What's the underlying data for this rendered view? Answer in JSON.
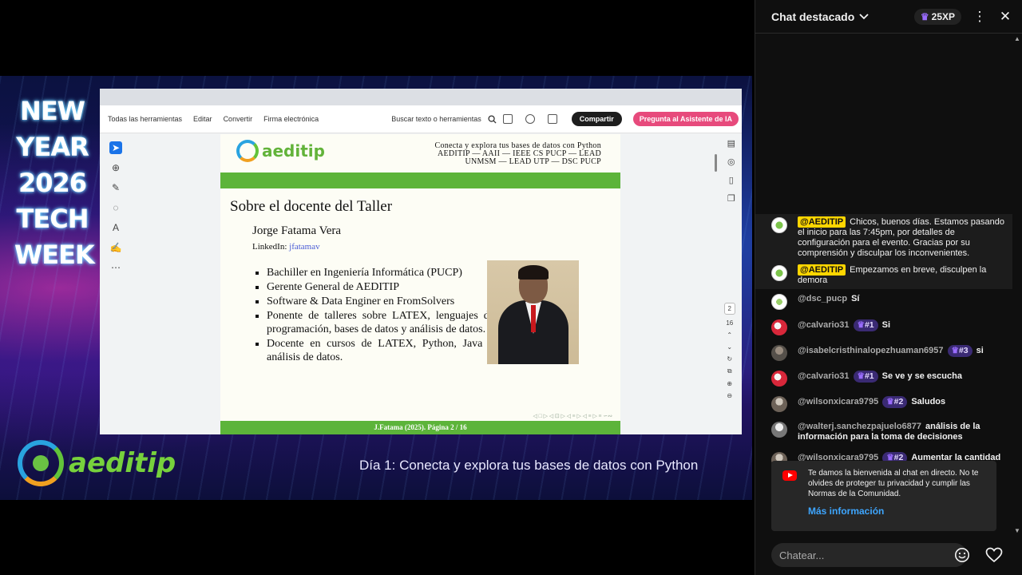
{
  "video": {
    "event_title": "NEW YEAR 2026 TECH WEEK",
    "brand_name": "aeditip",
    "caption": "Día 1: Conecta y explora tus bases de datos con Python"
  },
  "pdf_toolbar": {
    "all_tools": "Todas las herramientas",
    "edit": "Editar",
    "convert": "Convertir",
    "sign": "Firma electrónica",
    "search_placeholder": "Buscar texto o herramientas",
    "share_button": "Compartir",
    "ai_button": "Pregunta al Asistente de IA",
    "page_current": "2",
    "page_total": "16"
  },
  "slide": {
    "logo_text": "aeditip",
    "header_lines": [
      "Conecta y explora tus bases de datos con Python",
      "AEDITIP — AAII — IEEE CS PUCP — LEAD",
      "UNMSM — LEAD UTP — DSC PUCP"
    ],
    "title": "Sobre el docente del Taller",
    "name": "Jorge Fatama Vera",
    "linkedin_label": "LinkedIn:",
    "linkedin_handle": "jfatamav",
    "bullets": [
      "Bachiller en Ingeniería Informática (PUCP)",
      "Gerente General de AEDITIP",
      "Software & Data Enginer en FromSolvers",
      "Ponente de talleres sobre LATEX, lenguajes de programación, bases de datos y análisis de datos.",
      "Docente en cursos de LATEX, Python, Java y análisis de datos."
    ],
    "footer": "J.Fatama (2025). Página 2 / 16"
  },
  "chat": {
    "title": "Chat destacado",
    "xp": "25XP",
    "messages": [
      {
        "author": "@AEDITIP",
        "text": "Chicos, buenos días. Estamos pasando el inicio para las 7:45pm, por detalles de configuración para el evento. Gracias por su comprensión y disculpar los inconvenientes."
      },
      {
        "author": "@AEDITIP",
        "text": "Empezamos en breve, disculpen la demora"
      },
      {
        "author": "@dsc_pucp",
        "text": "Sí"
      },
      {
        "author": "@calvario31",
        "badge": "#1",
        "text": "Si"
      },
      {
        "author": "@isabelcristhinalopezhuaman6957",
        "badge": "#3",
        "text": "si"
      },
      {
        "author": "@calvario31",
        "badge": "#1",
        "text": "Se ve y se escucha"
      },
      {
        "author": "@wilsonxicara9795",
        "badge": "#2",
        "text": "Saludos"
      },
      {
        "author": "@walterj.sanchezpajuelo6877",
        "text": "análisis de la información para la toma de decisiones"
      },
      {
        "author": "@wilsonxicara9795",
        "badge": "#2",
        "text": "Aumentar la cantidad de ventas de esos productos"
      }
    ],
    "welcome_text": "Te damos la bienvenida al chat en directo. No te olvides de proteger tu privacidad y cumplir las Normas de la Comunidad.",
    "more_info": "Más información",
    "input_placeholder": "Chatear..."
  }
}
